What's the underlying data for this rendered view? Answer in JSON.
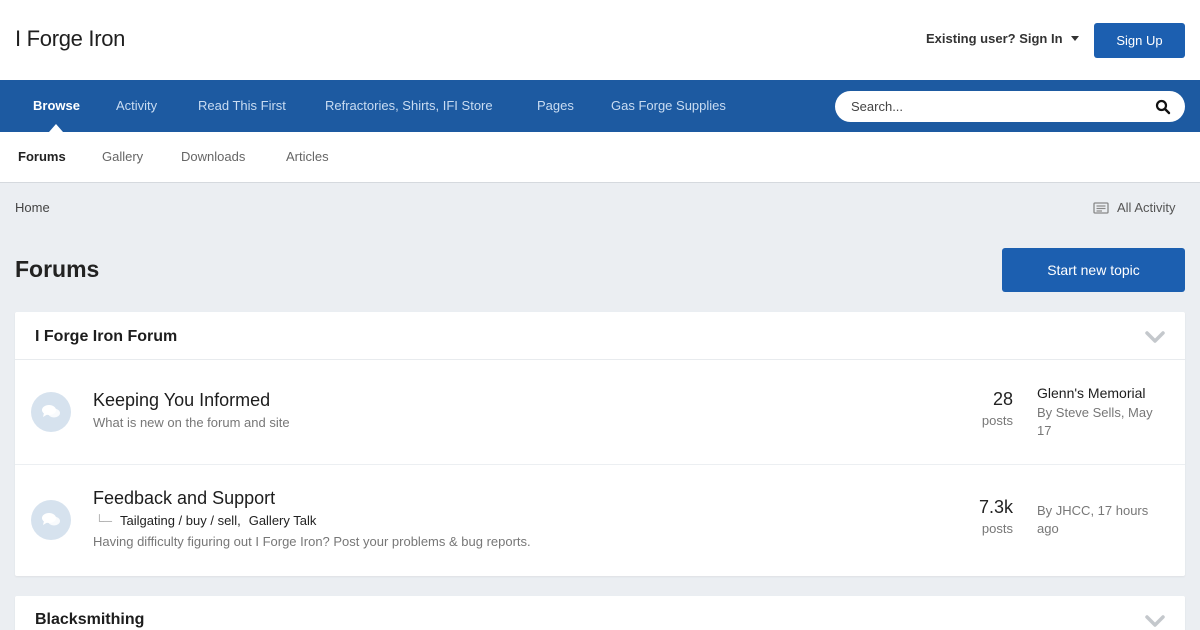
{
  "header": {
    "logo": "I Forge Iron",
    "signin_label": "Existing user? Sign In",
    "signup_label": "Sign Up"
  },
  "primary_nav": {
    "items": [
      {
        "label": "Browse",
        "active": true
      },
      {
        "label": "Activity"
      },
      {
        "label": "Read This First"
      },
      {
        "label": "Refractories, Shirts, IFI Store"
      },
      {
        "label": "Pages"
      },
      {
        "label": "Gas Forge Supplies"
      }
    ],
    "search_placeholder": "Search..."
  },
  "secondary_nav": {
    "items": [
      {
        "label": "Forums",
        "active": true
      },
      {
        "label": "Gallery"
      },
      {
        "label": "Downloads"
      },
      {
        "label": "Articles"
      }
    ]
  },
  "breadcrumb": {
    "home": "Home",
    "all_activity": "All Activity"
  },
  "page": {
    "title": "Forums",
    "start_topic_label": "Start new topic"
  },
  "categories": [
    {
      "title": "I Forge Iron Forum",
      "forums": [
        {
          "name": "Keeping You Informed",
          "description": "What is new on the forum and site",
          "posts": "28",
          "posts_label": "posts",
          "last_title": "Glenn's Memorial",
          "last_by": "By Steve Sells, May 17"
        },
        {
          "name": "Feedback and Support",
          "subforums": [
            "Tailgating / buy / sell,",
            "Gallery Talk"
          ],
          "description": "Having difficulty figuring out I Forge Iron? Post your problems & bug reports.",
          "posts": "7.3k",
          "posts_label": "posts",
          "last_by": "By JHCC, 17 hours ago"
        }
      ]
    },
    {
      "title": "Blacksmithing"
    }
  ],
  "colors": {
    "brand": "#1d5aa1",
    "button": "#1c5fb0",
    "background": "#ebeef2"
  }
}
